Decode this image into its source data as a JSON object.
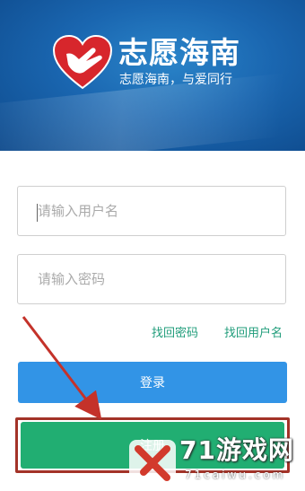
{
  "header": {
    "brand_name": "志愿海南",
    "slogan": "志愿海南，与爱同行"
  },
  "form": {
    "username_placeholder": "请输入用户名",
    "password_placeholder": "请输入密码",
    "forgot_password": "找回密码",
    "forgot_username": "找回用户名",
    "login_label": "登录",
    "register_label": "注册"
  },
  "watermark": {
    "text": "71游戏网",
    "sub": "71caiwu.com"
  },
  "colors": {
    "banner": "#1a66b0",
    "link": "#1f9c7a",
    "login_button": "#3294e6",
    "register_button": "#21ae72",
    "highlight": "#a33328"
  }
}
